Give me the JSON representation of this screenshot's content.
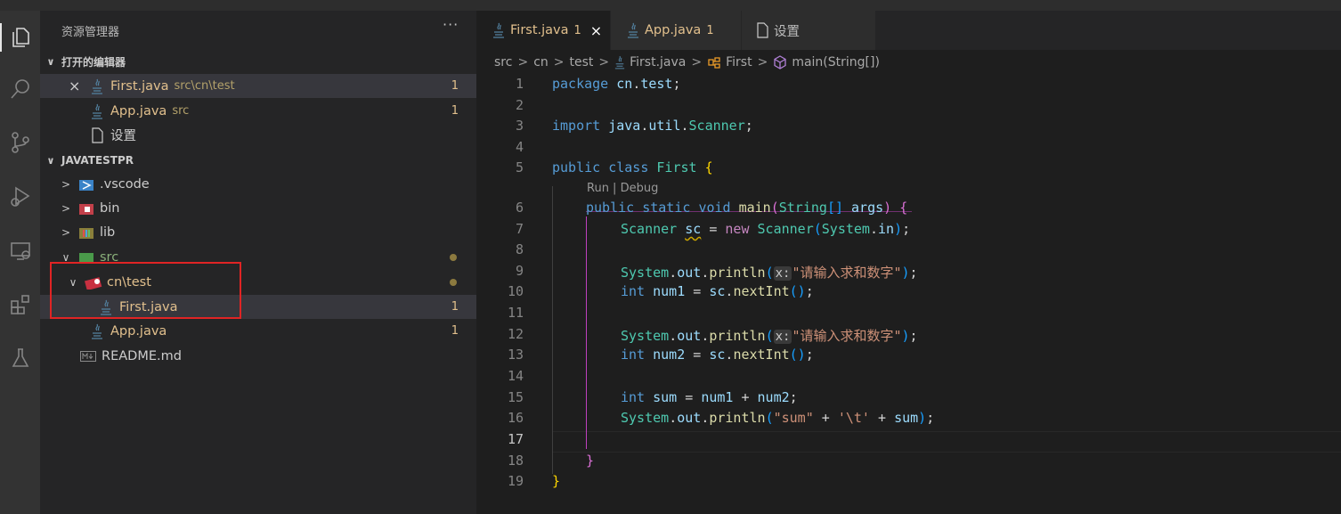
{
  "activity_bar": {
    "icons": [
      "explorer-icon",
      "search-icon",
      "source-control-icon",
      "run-debug-icon",
      "remote-explorer-icon",
      "extensions-icon",
      "testing-icon"
    ]
  },
  "sidebar": {
    "title": "资源管理器",
    "more": "···",
    "open_editors": {
      "header": "打开的编辑器",
      "items": [
        {
          "name": "First.java",
          "path": "src\\cn\\test",
          "badge": "1"
        },
        {
          "name": "App.java",
          "path": "src",
          "badge": "1"
        },
        {
          "name": "设置"
        }
      ]
    },
    "project": {
      "header": "JAVATESTPR",
      "items": [
        {
          "name": ".vscode"
        },
        {
          "name": "bin"
        },
        {
          "name": "lib"
        },
        {
          "name": "src"
        },
        {
          "name": "cn\\test"
        },
        {
          "name": "First.java",
          "badge": "1"
        },
        {
          "name": "App.java",
          "badge": "1"
        },
        {
          "name": "README.md"
        }
      ]
    }
  },
  "tabs": [
    {
      "name": "First.java",
      "badge": "1",
      "close": "×"
    },
    {
      "name": "App.java",
      "badge": "1"
    },
    {
      "name": "设置"
    }
  ],
  "breadcrumbs": [
    "src",
    "cn",
    "test",
    "First.java",
    "First",
    "main(String[])"
  ],
  "code": {
    "line_numbers": [
      "1",
      "2",
      "3",
      "4",
      "5",
      "6",
      "7",
      "8",
      "9",
      "10",
      "11",
      "12",
      "13",
      "14",
      "15",
      "16",
      "17",
      "18",
      "19"
    ],
    "current_line": "17",
    "lens": "Run | Debug",
    "hint_label": "x:",
    "string_prompt": "\"请输入求和数字\"",
    "string_sum": "\"sum\"",
    "char_tab": "'\\t'"
  },
  "colors": {
    "modified": "#e2c08d",
    "annotation": "#e02424"
  }
}
